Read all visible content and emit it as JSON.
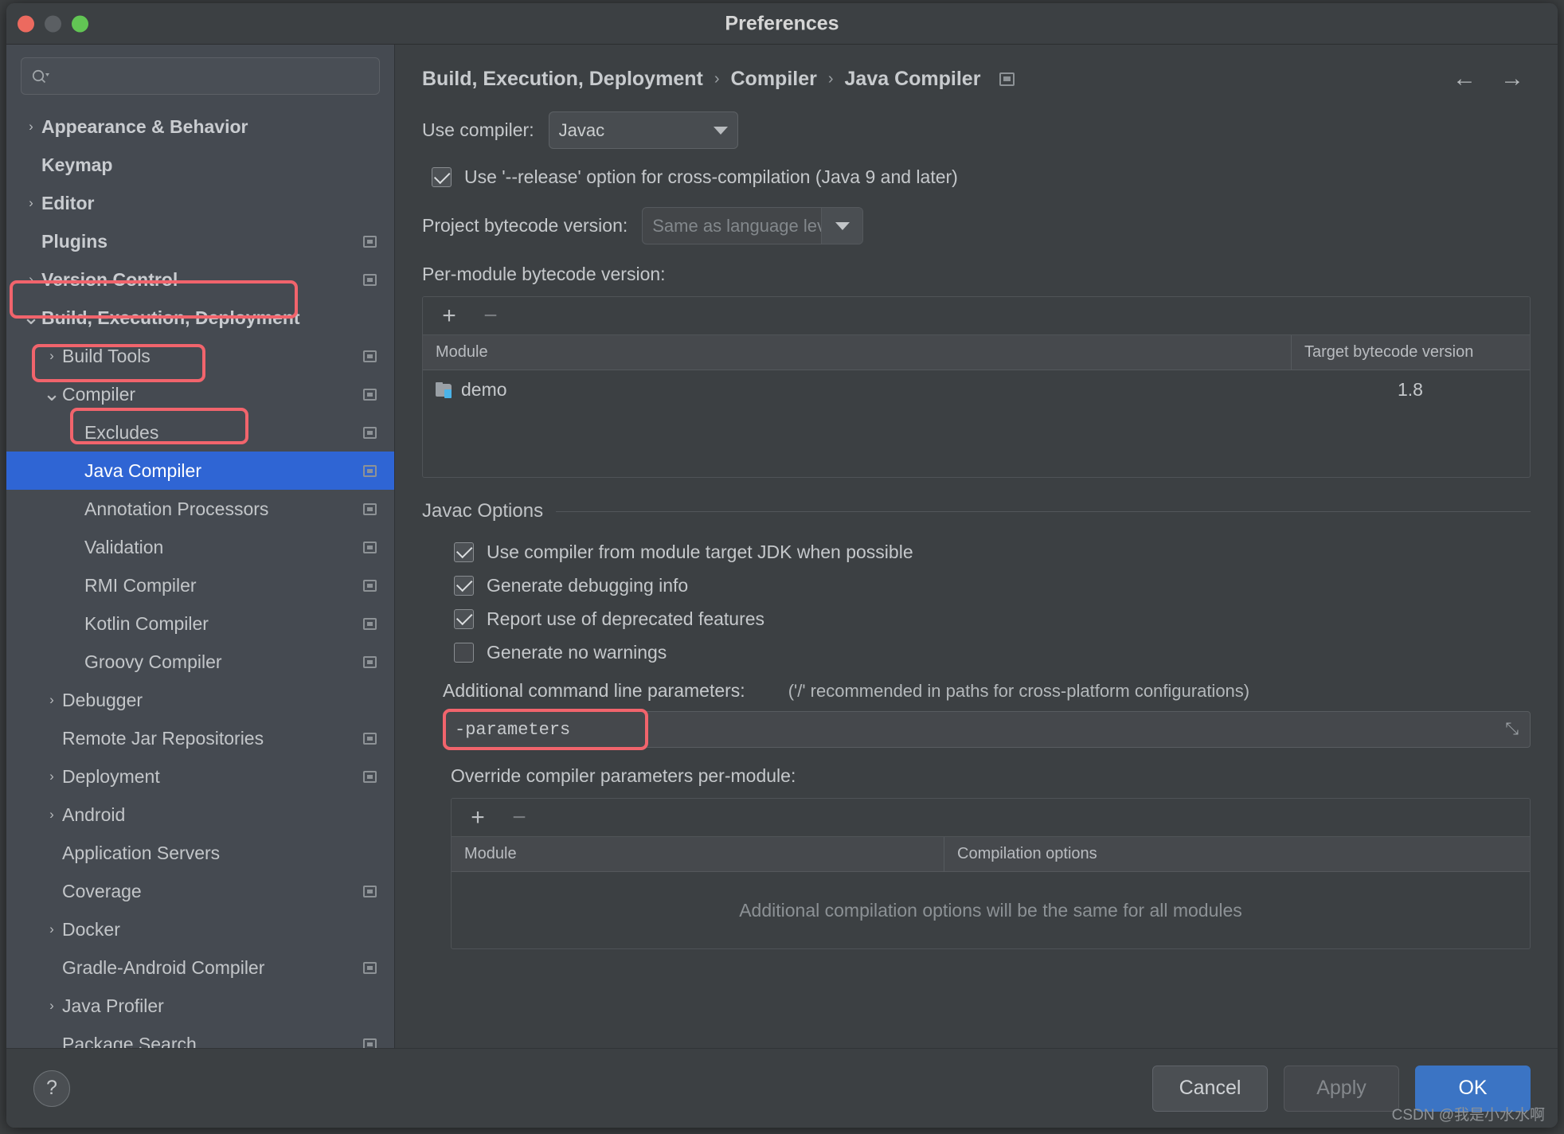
{
  "window": {
    "title": "Preferences",
    "traffic_lights": [
      "close",
      "minimize",
      "zoom"
    ]
  },
  "search": {
    "placeholder": "",
    "value": "",
    "icon": "search-icon"
  },
  "sidebar": {
    "items": [
      {
        "label": "Appearance & Behavior",
        "indent": 0,
        "chevron": "right",
        "bold": true,
        "badge": false,
        "selected": false
      },
      {
        "label": "Keymap",
        "indent": 0,
        "chevron": "none",
        "bold": true,
        "badge": false,
        "selected": false
      },
      {
        "label": "Editor",
        "indent": 0,
        "chevron": "right",
        "bold": true,
        "badge": false,
        "selected": false
      },
      {
        "label": "Plugins",
        "indent": 0,
        "chevron": "none",
        "bold": true,
        "badge": true,
        "selected": false
      },
      {
        "label": "Version Control",
        "indent": 0,
        "chevron": "right",
        "bold": true,
        "badge": true,
        "selected": false
      },
      {
        "label": "Build, Execution, Deployment",
        "indent": 0,
        "chevron": "down",
        "bold": true,
        "badge": false,
        "selected": false
      },
      {
        "label": "Build Tools",
        "indent": 1,
        "chevron": "right",
        "bold": false,
        "badge": true,
        "selected": false
      },
      {
        "label": "Compiler",
        "indent": 1,
        "chevron": "down",
        "bold": false,
        "badge": true,
        "selected": false
      },
      {
        "label": "Excludes",
        "indent": 2,
        "chevron": "none",
        "bold": false,
        "badge": true,
        "selected": false
      },
      {
        "label": "Java Compiler",
        "indent": 2,
        "chevron": "none",
        "bold": false,
        "badge": true,
        "selected": true
      },
      {
        "label": "Annotation Processors",
        "indent": 2,
        "chevron": "none",
        "bold": false,
        "badge": true,
        "selected": false
      },
      {
        "label": "Validation",
        "indent": 2,
        "chevron": "none",
        "bold": false,
        "badge": true,
        "selected": false
      },
      {
        "label": "RMI Compiler",
        "indent": 2,
        "chevron": "none",
        "bold": false,
        "badge": true,
        "selected": false
      },
      {
        "label": "Kotlin Compiler",
        "indent": 2,
        "chevron": "none",
        "bold": false,
        "badge": true,
        "selected": false
      },
      {
        "label": "Groovy Compiler",
        "indent": 2,
        "chevron": "none",
        "bold": false,
        "badge": true,
        "selected": false
      },
      {
        "label": "Debugger",
        "indent": 1,
        "chevron": "right",
        "bold": false,
        "badge": false,
        "selected": false
      },
      {
        "label": "Remote Jar Repositories",
        "indent": 1,
        "chevron": "none",
        "bold": false,
        "badge": true,
        "selected": false
      },
      {
        "label": "Deployment",
        "indent": 1,
        "chevron": "right",
        "bold": false,
        "badge": true,
        "selected": false
      },
      {
        "label": "Android",
        "indent": 1,
        "chevron": "right",
        "bold": false,
        "badge": false,
        "selected": false
      },
      {
        "label": "Application Servers",
        "indent": 1,
        "chevron": "none",
        "bold": false,
        "badge": false,
        "selected": false
      },
      {
        "label": "Coverage",
        "indent": 1,
        "chevron": "none",
        "bold": false,
        "badge": true,
        "selected": false
      },
      {
        "label": "Docker",
        "indent": 1,
        "chevron": "right",
        "bold": false,
        "badge": false,
        "selected": false
      },
      {
        "label": "Gradle-Android Compiler",
        "indent": 1,
        "chevron": "none",
        "bold": false,
        "badge": true,
        "selected": false
      },
      {
        "label": "Java Profiler",
        "indent": 1,
        "chevron": "right",
        "bold": false,
        "badge": false,
        "selected": false
      },
      {
        "label": "Package Search",
        "indent": 1,
        "chevron": "none",
        "bold": false,
        "badge": true,
        "selected": false
      }
    ]
  },
  "breadcrumb": {
    "items": [
      "Build, Execution, Deployment",
      "Compiler",
      "Java Compiler"
    ],
    "separator": "›",
    "badge_icon": "project-scope-icon",
    "back_icon": "←",
    "forward_icon": "→"
  },
  "main": {
    "use_compiler_label": "Use compiler:",
    "use_compiler_value": "Javac",
    "release_option_label": "Use '--release' option for cross-compilation (Java 9 and later)",
    "release_option_checked": true,
    "project_bytecode_label": "Project bytecode version:",
    "project_bytecode_value": "Same as language level",
    "per_module_label": "Per-module bytecode version:",
    "add_icon": "+",
    "remove_icon": "−",
    "module_table": {
      "columns": [
        "Module",
        "Target bytecode version"
      ],
      "rows": [
        {
          "module": "demo",
          "target": "1.8"
        }
      ]
    },
    "javac_options_title": "Javac Options",
    "javac_checkboxes": [
      {
        "label": "Use compiler from module target JDK when possible",
        "checked": true
      },
      {
        "label": "Generate debugging info",
        "checked": true
      },
      {
        "label": "Report use of deprecated features",
        "checked": true
      },
      {
        "label": "Generate no warnings",
        "checked": false
      }
    ],
    "additional_params_label": "Additional command line parameters:",
    "additional_params_hint": "('/' recommended in paths for cross-platform configurations)",
    "additional_params_value": "-parameters",
    "expand_icon": "⤡",
    "override_label": "Override compiler parameters per-module:",
    "override_table": {
      "columns": [
        "Module",
        "Compilation options"
      ],
      "empty_message": "Additional compilation options will be the same for all modules"
    }
  },
  "footer": {
    "help_label": "?",
    "cancel_label": "Cancel",
    "apply_label": "Apply",
    "ok_label": "OK"
  },
  "watermark": "CSDN @我是小水水啊",
  "colors": {
    "accent": "#3b74c4",
    "annotation": "#f1646c",
    "selection": "#2f65d4",
    "sidebar_bg": "#454a51",
    "panel_bg": "#3c4043"
  }
}
